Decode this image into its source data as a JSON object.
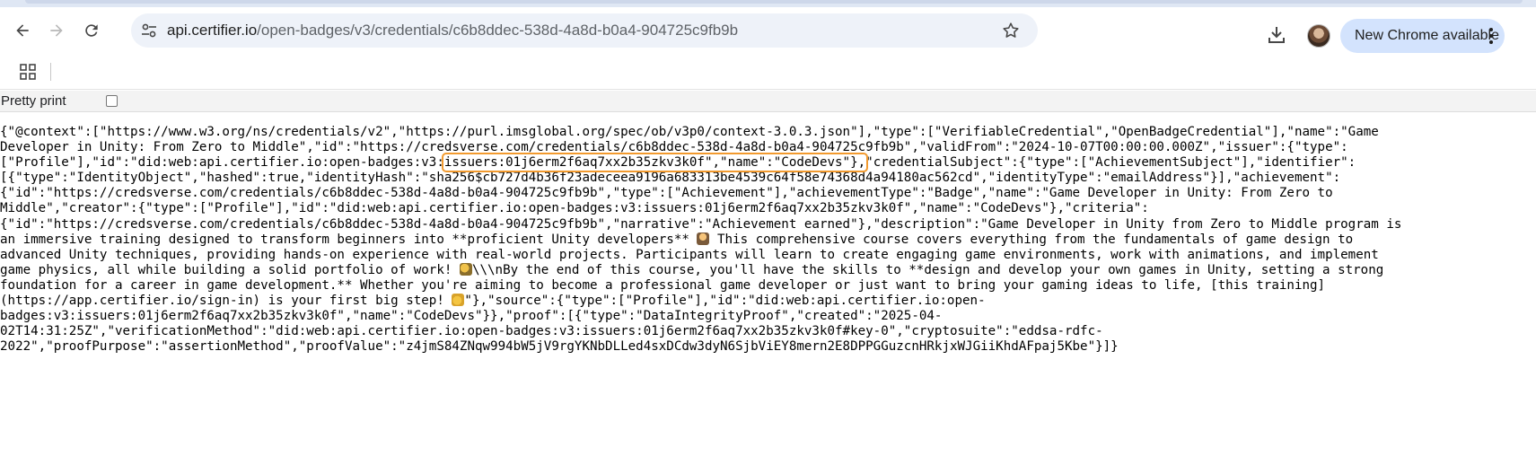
{
  "browser": {
    "url_host": "api.certifier.io",
    "url_path": "/open-badges/v3/credentials/c6b8ddec-538d-4a8d-b0a4-904725c9fb9b",
    "new_chrome_label": "New Chrome available",
    "icons": [
      "back-icon",
      "forward-icon",
      "reload-icon",
      "site-info-icon",
      "star-icon",
      "download-icon",
      "more-vert-icon",
      "apps-icon"
    ]
  },
  "viewer": {
    "pretty_print_label": "Pretty print",
    "pretty_print_checked": false
  },
  "json_lines": [
    "{\"@context\":[\"https://www.w3.org/ns/credentials/v2\",\"https://purl.imsglobal.org/spec/ob/v3p0/context-3.0.3.json\"],\"type\":[\"VerifiableCredential\",\"OpenBadgeCredential\"],\"name\":\"Game",
    "Developer in Unity: From Zero to Middle\",\"id\":\"https://credsverse.com/credentials/c6b8ddec-538d-4a8d-b0a4-904725c9fb9b\",\"validFrom\":\"2024-10-07T00:00:00.000Z\",\"issuer\":{\"type\":",
    {
      "pre": "[\"Profile\"],\"id\":\"did:web:api.certifier.io:open-badges:v3:",
      "highlight": "issuers:01j6erm2f6aq7xx2b35zkv3k0f\",\"name\":\"CodeDevs\"},",
      "post": "\"credentialSubject\":{\"type\":[\"AchievementSubject\"],\"identifier\":"
    },
    "[{\"type\":\"IdentityObject\",\"hashed\":true,\"identityHash\":\"sha256$cb727d4b36f23adeceea9196a683313be4539c64f58e74368d4a94180ac562cd\",\"identityType\":\"emailAddress\"}],\"achievement\":",
    "{\"id\":\"https://credsverse.com/credentials/c6b8ddec-538d-4a8d-b0a4-904725c9fb9b\",\"type\":[\"Achievement\"],\"achievementType\":\"Badge\",\"name\":\"Game Developer in Unity: From Zero to",
    "Middle\",\"creator\":{\"type\":[\"Profile\"],\"id\":\"did:web:api.certifier.io:open-badges:v3:issuers:01j6erm2f6aq7xx2b35zkv3k0f\",\"name\":\"CodeDevs\"},\"criteria\":",
    "{\"id\":\"https://credsverse.com/credentials/c6b8ddec-538d-4a8d-b0a4-904725c9fb9b\",\"narrative\":\"Achievement earned\"},\"description\":\"Game Developer in Unity from Zero to Middle program is",
    {
      "pre": "an immersive training designed to transform beginners into **proficient Unity developers** ",
      "emoji": "e1",
      "post": " This comprehensive course covers everything from the fundamentals of game design to"
    },
    "advanced Unity techniques, providing hands-on experience with real-world projects. Participants will learn to create engaging game environments, work with animations, and implement",
    {
      "pre": "game physics, all while building a solid portfolio of work! ",
      "emoji": "e2",
      "post": "\\\\\\nBy the end of this course, you'll have the skills to **design and develop your own games in Unity, setting a strong"
    },
    "foundation for a career in game development.** Whether you're aiming to become a professional game developer or just want to bring your gaming ideas to life, [this training]",
    {
      "pre": "(https://app.certifier.io/sign-in) is your first big step! ",
      "emoji": "e3",
      "post": "\"},\"source\":{\"type\":[\"Profile\"],\"id\":\"did:web:api.certifier.io:open-"
    },
    "badges:v3:issuers:01j6erm2f6aq7xx2b35zkv3k0f\",\"name\":\"CodeDevs\"}},\"proof\":[{\"type\":\"DataIntegrityProof\",\"created\":\"2025-04-",
    "02T14:31:25Z\",\"verificationMethod\":\"did:web:api.certifier.io:open-badges:v3:issuers:01j6erm2f6aq7xx2b35zkv3k0f#key-0\",\"cryptosuite\":\"eddsa-rdfc-",
    "2022\",\"proofPurpose\":\"assertionMethod\",\"proofValue\":\"z4jmS84ZNqw994bW5jV9rgYKNbDLLed4sxDCdw3dyN6SjbViEY8mern2E8DPPGGuzcnHRkjxWJGiiKhdAFpaj5Kbe\"}]}"
  ]
}
